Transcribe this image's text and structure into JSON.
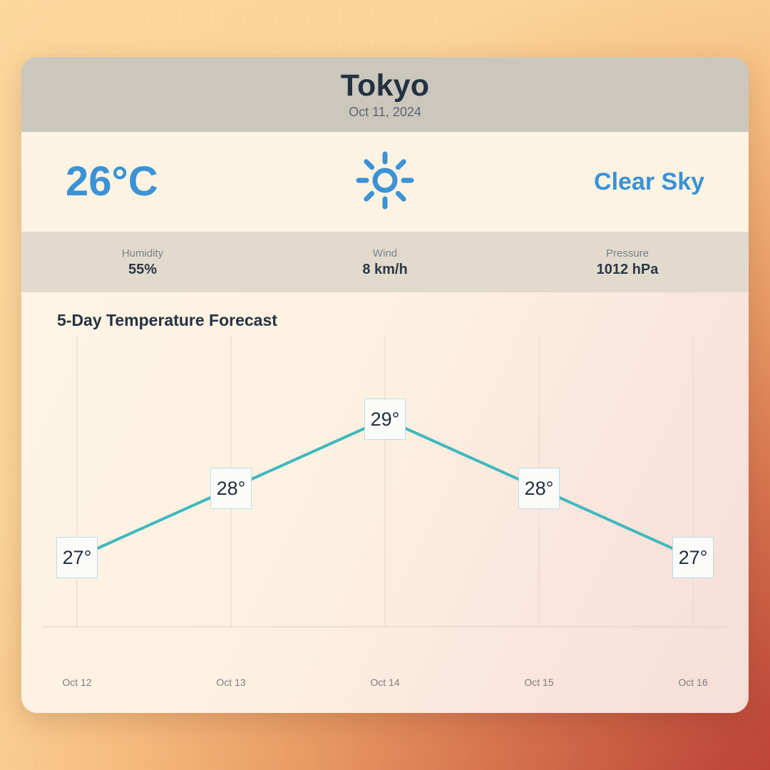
{
  "header": {
    "city": "Tokyo",
    "date": "Oct 11, 2024"
  },
  "current": {
    "temperature": "26°C",
    "condition": "Clear Sky",
    "icon": "sun-icon",
    "accent_color": "#3b92d4"
  },
  "stats": [
    {
      "label": "Humidity",
      "value": "55%"
    },
    {
      "label": "Wind",
      "value": "8 km/h"
    },
    {
      "label": "Pressure",
      "value": "1012 hPa"
    }
  ],
  "forecast": {
    "title": "5-Day Temperature Forecast",
    "line_color": "#3fb8be",
    "label_border_color": "#b9e0e3"
  },
  "chart_data": {
    "type": "line",
    "title": "5-Day Temperature Forecast",
    "xlabel": "",
    "ylabel": "",
    "categories": [
      "Oct 12",
      "Oct 13",
      "Oct 14",
      "Oct 15",
      "Oct 16"
    ],
    "values": [
      27,
      28,
      29,
      28,
      27
    ],
    "point_labels": [
      "27°",
      "28°",
      "29°",
      "28°",
      "27°"
    ],
    "ylim": [
      26,
      30
    ],
    "grid": "vertical",
    "legend": "none",
    "series": [
      {
        "name": "Temperature",
        "values": [
          27,
          28,
          29,
          28,
          27
        ]
      }
    ]
  }
}
